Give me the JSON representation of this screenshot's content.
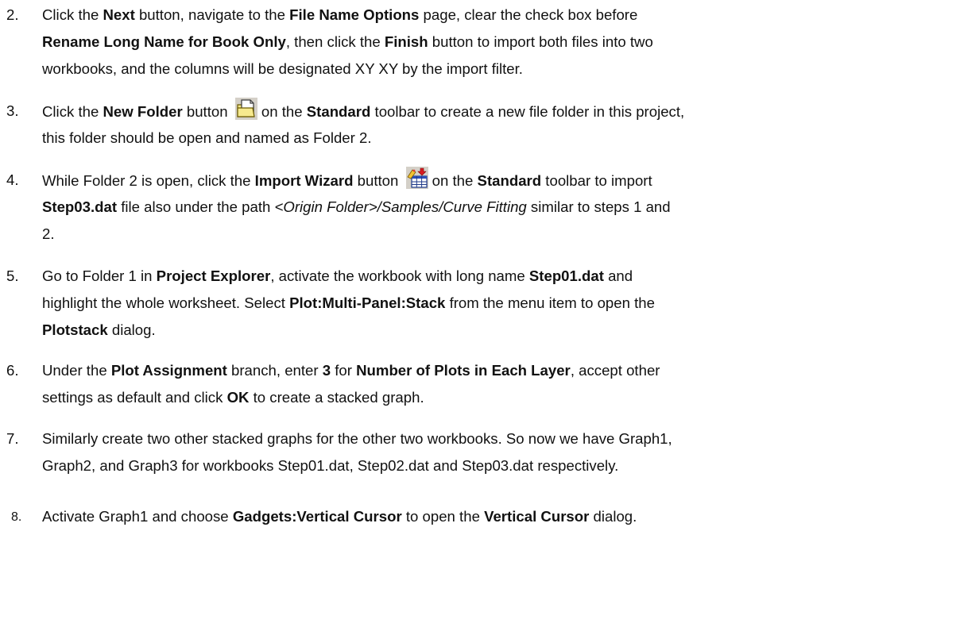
{
  "steps": [
    {
      "number": "2.",
      "lines": [
        [
          {
            "t": "Click the "
          },
          {
            "t": "Next",
            "b": true
          },
          {
            "t": " button, navigate to the "
          },
          {
            "t": "File Name Options",
            "b": true
          },
          {
            "t": " page, clear the check box before"
          }
        ],
        [
          {
            "t": "Rename Long Name for Book Only",
            "b": true
          },
          {
            "t": ", then click the "
          },
          {
            "t": "Finish",
            "b": true
          },
          {
            "t": " button to import both files into two"
          }
        ],
        [
          {
            "t": "workbooks, and the columns will be designated XY XY by the import filter."
          }
        ]
      ]
    },
    {
      "number": "3.",
      "lines": [
        [
          {
            "t": "Click the "
          },
          {
            "t": "New Folder",
            "b": true
          },
          {
            "t": " button "
          },
          {
            "icon": "new-folder-icon"
          },
          {
            "t": "on the "
          },
          {
            "t": "Standard",
            "b": true
          },
          {
            "t": " toolbar to create a new file folder in this project,"
          }
        ],
        [
          {
            "t": "this folder should be open and named as Folder 2."
          }
        ]
      ]
    },
    {
      "number": "4.",
      "lines": [
        [
          {
            "t": "While Folder 2 is open, click the "
          },
          {
            "t": "Import Wizard",
            "b": true
          },
          {
            "t": " button "
          },
          {
            "icon": "import-wizard-icon"
          },
          {
            "t": "on the "
          },
          {
            "t": "Standard",
            "b": true
          },
          {
            "t": " toolbar to import"
          }
        ],
        [
          {
            "t": "Step03.dat",
            "b": true
          },
          {
            "t": " file also under the path "
          },
          {
            "t": "<Origin Folder>/Samples/Curve Fitting",
            "i": true
          },
          {
            "t": " similar to steps 1 and"
          }
        ],
        [
          {
            "t": "2."
          }
        ]
      ]
    },
    {
      "number": "5.",
      "lines": [
        [
          {
            "t": "Go to Folder 1 in "
          },
          {
            "t": "Project Explorer",
            "b": true
          },
          {
            "t": ", activate the workbook with long name "
          },
          {
            "t": "Step01.dat",
            "b": true
          },
          {
            "t": " and"
          }
        ],
        [
          {
            "t": "highlight the whole worksheet. Select "
          },
          {
            "t": "Plot:Multi-Panel:Stack",
            "b": true
          },
          {
            "t": " from the menu item to open the"
          }
        ],
        [
          {
            "t": "Plotstack",
            "b": true
          },
          {
            "t": " dialog."
          }
        ]
      ]
    },
    {
      "number": "6.",
      "lines": [
        [
          {
            "t": "Under the "
          },
          {
            "t": "Plot Assignment",
            "b": true
          },
          {
            "t": " branch, enter "
          },
          {
            "t": "3",
            "b": true
          },
          {
            "t": " for "
          },
          {
            "t": "Number of Plots in Each Layer",
            "b": true
          },
          {
            "t": ", accept other"
          }
        ],
        [
          {
            "t": "settings as default and click "
          },
          {
            "t": "OK",
            "b": true
          },
          {
            "t": " to create a stacked graph."
          }
        ]
      ]
    },
    {
      "number": "7.",
      "lines": [
        [
          {
            "t": "Similarly create two other stacked graphs for the other two workbooks. So now we have Graph1,"
          }
        ],
        [
          {
            "t": "Graph2, and Graph3 for workbooks Step01.dat, Step02.dat and Step03.dat respectively."
          }
        ]
      ]
    },
    {
      "number": "8.",
      "lines": [
        [
          {
            "t": "Activate Graph1 and choose "
          },
          {
            "t": "Gadgets:Vertical Cursor",
            "b": true
          },
          {
            "t": " to open the "
          },
          {
            "t": "Vertical Cursor",
            "b": true
          },
          {
            "t": " dialog."
          }
        ]
      ]
    }
  ]
}
